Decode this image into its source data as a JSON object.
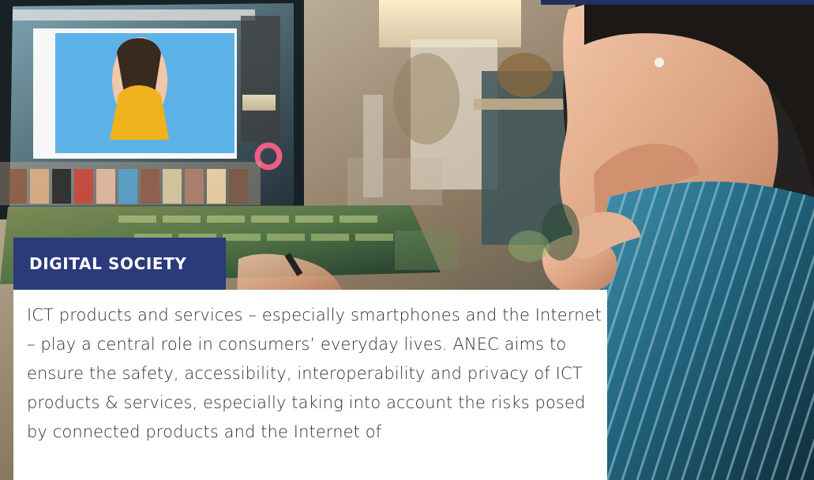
{
  "section": {
    "label": "DIGITAL SOCIETY",
    "body": "ICT products and services – especially smartphones and the Internet – play a central role in consumers’ everyday lives. ANEC aims to ensure the safety, accessibility, interoperability and privacy of ICT products & services, especially taking into account the risks posed by connected products and the Internet of"
  },
  "colors": {
    "label_background": "#2a3a7b",
    "label_text": "#ffffff",
    "panel_background": "#ffffff",
    "body_text": "#2f2f2f",
    "top_band": "#222f63"
  },
  "image": {
    "subject": "woman-editing-photo-on-monitor"
  }
}
